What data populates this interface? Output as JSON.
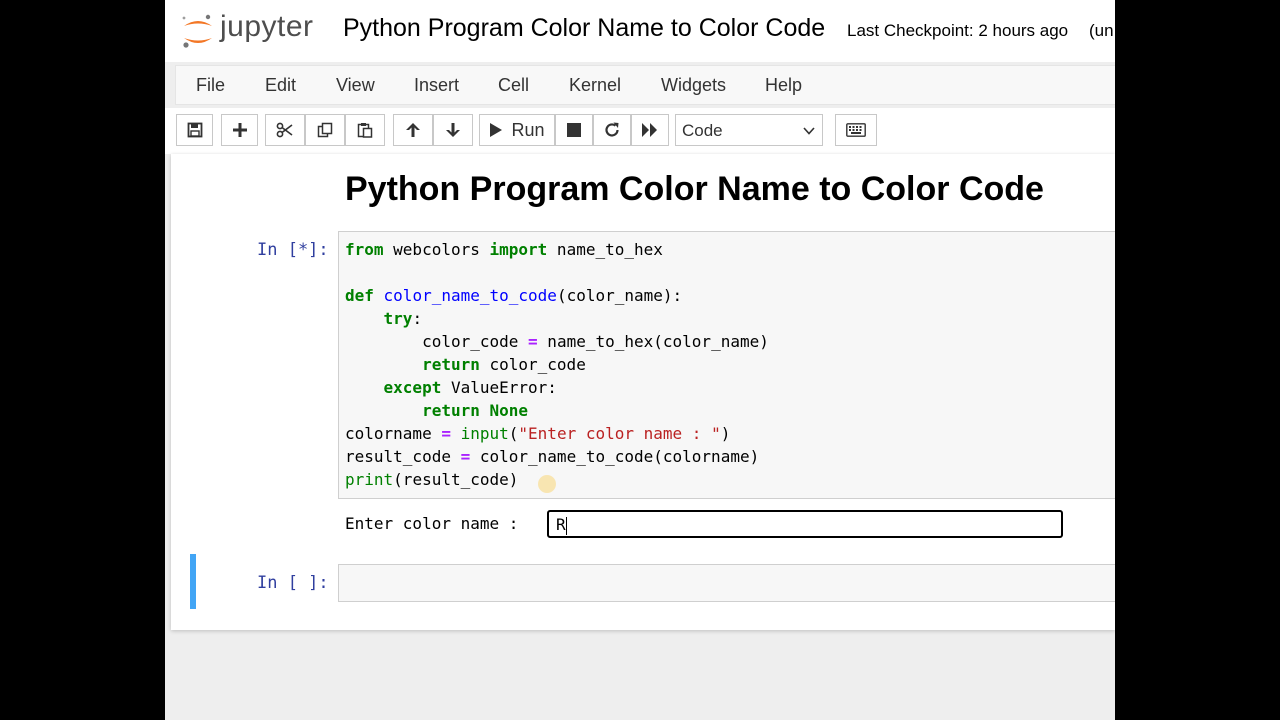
{
  "header": {
    "logo_text": "jupyter",
    "notebook_title": "Python Program Color Name to Color Code",
    "checkpoint": "Last Checkpoint: 2 hours ago",
    "autosave": "(un"
  },
  "menu": [
    "File",
    "Edit",
    "View",
    "Insert",
    "Cell",
    "Kernel",
    "Widgets",
    "Help"
  ],
  "toolbar": {
    "run_label": "Run",
    "cell_type": "Code",
    "icons": [
      "save-icon",
      "plus-icon",
      "cut-icon",
      "copy-icon",
      "paste-icon",
      "arrow-up-icon",
      "arrow-down-icon",
      "play-icon",
      "stop-icon",
      "restart-icon",
      "fast-forward-icon",
      "keyboard-icon"
    ]
  },
  "notebook": {
    "markdown_title": "Python Program Color Name to Color Code",
    "cell1": {
      "prompt": "In [*]:",
      "code_lines": [
        "from webcolors import name_to_hex",
        "",
        "def color_name_to_code(color_name):",
        "    try:",
        "        color_code = name_to_hex(color_name)",
        "        return color_code",
        "    except ValueError:",
        "        return None",
        "colorname = input(\"Enter color name : \")",
        "result_code = color_name_to_code(colorname)",
        "print(result_code)"
      ],
      "stdin_prompt": "Enter color name : ",
      "stdin_value": "R"
    },
    "cell2": {
      "prompt": "In [ ]:"
    }
  },
  "colors": {
    "prompt": "#303f9f",
    "selected_cell_bar": "#42a5f5",
    "keyword": "#008000",
    "operator": "#aa22ff",
    "function_name": "#0000ff",
    "string": "#ba2121"
  }
}
